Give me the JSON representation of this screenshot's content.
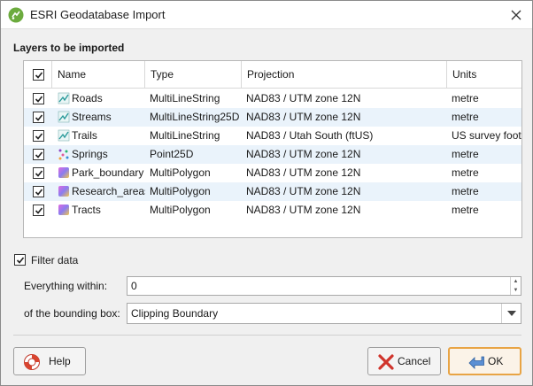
{
  "window": {
    "title": "ESRI Geodatabase Import"
  },
  "layers_section": {
    "label": "Layers to be imported",
    "columns": [
      "Name",
      "Type",
      "Projection",
      "Units"
    ],
    "rows": [
      {
        "name": "Roads",
        "type": "MultiLineString",
        "projection": "NAD83 / UTM zone 12N",
        "units": "metre",
        "checked": true,
        "icon": "line-layer-icon"
      },
      {
        "name": "Streams",
        "type": "MultiLineString25D",
        "projection": "NAD83 / UTM zone 12N",
        "units": "metre",
        "checked": true,
        "icon": "line-layer-icon"
      },
      {
        "name": "Trails",
        "type": "MultiLineString",
        "projection": "NAD83 / Utah South (ftUS)",
        "units": "US survey foot",
        "checked": true,
        "icon": "line-layer-icon"
      },
      {
        "name": "Springs",
        "type": "Point25D",
        "projection": "NAD83 / UTM zone 12N",
        "units": "metre",
        "checked": true,
        "icon": "point-layer-icon"
      },
      {
        "name": "Park_boundary",
        "type": "MultiPolygon",
        "projection": "NAD83 / UTM zone 12N",
        "units": "metre",
        "checked": true,
        "icon": "polygon-layer-icon"
      },
      {
        "name": "Research_areas",
        "type": "MultiPolygon",
        "projection": "NAD83 / UTM zone 12N",
        "units": "metre",
        "checked": true,
        "icon": "polygon-layer-icon"
      },
      {
        "name": "Tracts",
        "type": "MultiPolygon",
        "projection": "NAD83 / UTM zone 12N",
        "units": "metre",
        "checked": true,
        "icon": "polygon-layer-icon"
      }
    ]
  },
  "filter": {
    "label": "Filter data",
    "checked": true,
    "within_label": "Everything within:",
    "within_value": "0",
    "bbox_label": "of the bounding box:",
    "bbox_value": "Clipping Boundary"
  },
  "buttons": {
    "help": "Help",
    "cancel": "Cancel",
    "ok": "OK"
  },
  "colors": {
    "accent_ok_border": "#e8a445",
    "row_alt": "#eaf3fb"
  }
}
